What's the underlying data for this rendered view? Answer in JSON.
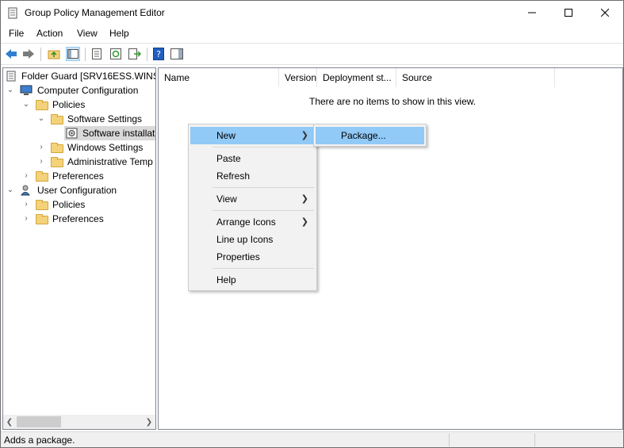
{
  "window": {
    "title": "Group Policy Management Editor"
  },
  "menubar": {
    "items": [
      "File",
      "Action",
      "View",
      "Help"
    ]
  },
  "toolbar": {
    "buttons": [
      "back-icon",
      "forward-icon",
      "up-folder-icon",
      "show-hide-tree-icon",
      "properties-icon",
      "refresh-icon",
      "export-list-icon",
      "help-icon",
      "show-hide-action-pane-icon"
    ]
  },
  "tree": {
    "root": "Folder Guard [SRV16ESS.WINSO",
    "computer_config": "Computer Configuration",
    "cc_policies": "Policies",
    "software_settings": "Software Settings",
    "software_installation": "Software installat",
    "windows_settings": "Windows Settings",
    "admin_templates": "Administrative Temp",
    "cc_preferences": "Preferences",
    "user_config": "User Configuration",
    "uc_policies": "Policies",
    "uc_preferences": "Preferences"
  },
  "list": {
    "columns": [
      "Name",
      "Version",
      "Deployment st...",
      "Source"
    ],
    "empty_message": "There are no items to show in this view."
  },
  "context_menu": {
    "new": "New",
    "paste": "Paste",
    "refresh": "Refresh",
    "view": "View",
    "arrange_icons": "Arrange Icons",
    "line_up_icons": "Line up Icons",
    "properties": "Properties",
    "help": "Help"
  },
  "submenu": {
    "package": "Package..."
  },
  "statusbar": {
    "text": "Adds a package."
  },
  "colors": {
    "highlight": "#91c9f7",
    "folder": "#f4d27a"
  }
}
